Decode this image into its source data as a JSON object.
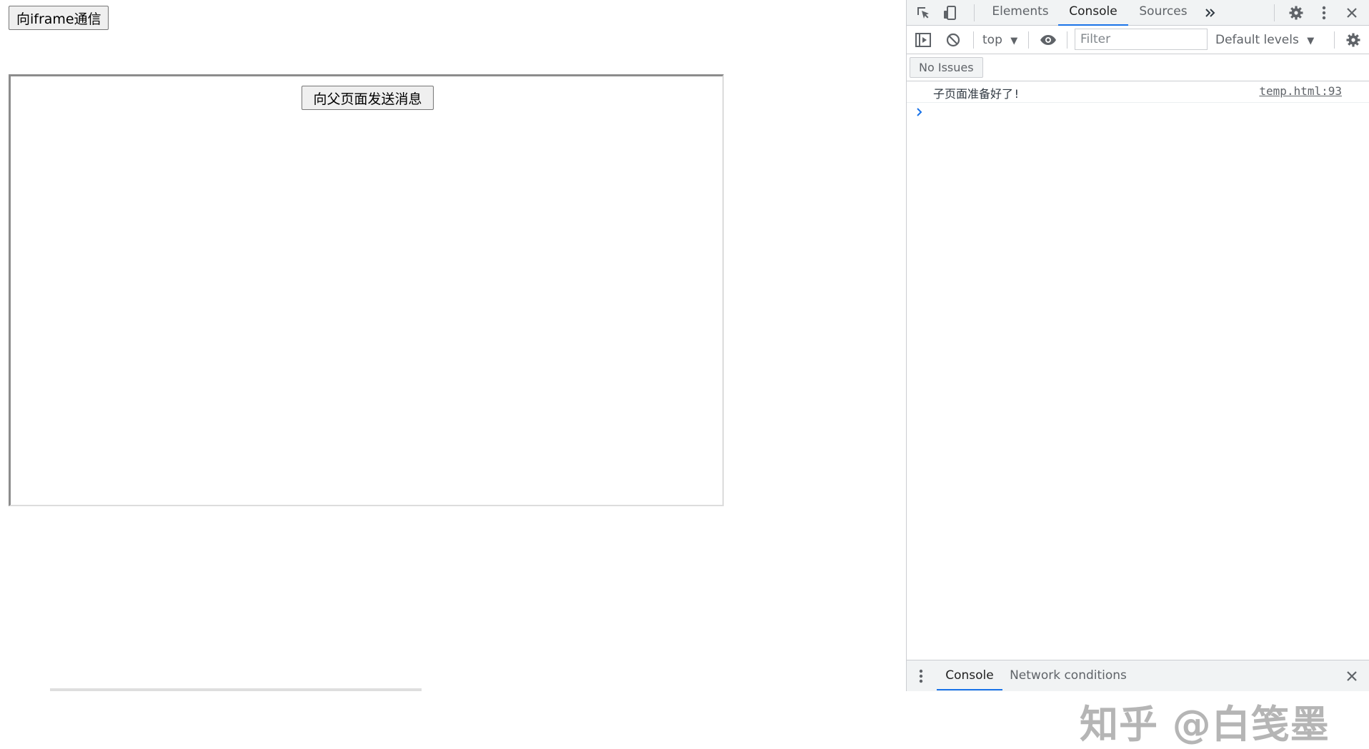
{
  "page": {
    "parent_button_label": "向iframe通信",
    "iframe": {
      "child_button_label": "向父页面发送消息"
    }
  },
  "devtools": {
    "tabs": [
      {
        "label": "Elements",
        "active": false
      },
      {
        "label": "Console",
        "active": true
      },
      {
        "label": "Sources",
        "active": false
      }
    ],
    "more_tabs_icon": "double-chevron-right-icon",
    "toolbar": {
      "context": "top",
      "filter_placeholder": "Filter",
      "levels": "Default levels"
    },
    "issues_button": "No Issues",
    "console": {
      "messages": [
        {
          "text": "子页面准备好了!",
          "source": "temp.html:93"
        }
      ]
    },
    "drawer": {
      "tabs": [
        {
          "label": "Console",
          "active": true
        },
        {
          "label": "Network conditions",
          "active": false
        }
      ]
    },
    "accent_color": "#1a73e8"
  },
  "watermark": "知乎 @白笺墨"
}
